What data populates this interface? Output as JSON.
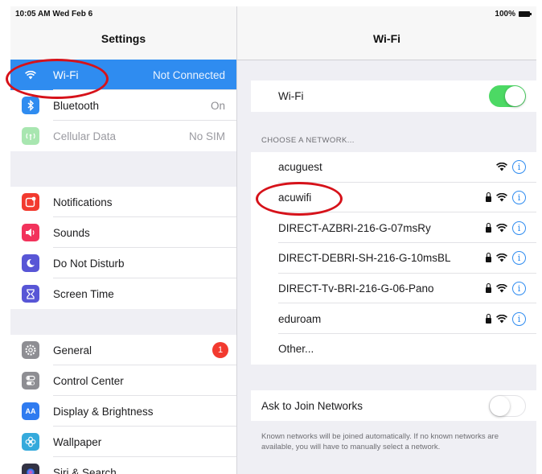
{
  "status_bar": {
    "time": "10:05 AM  Wed Feb 6",
    "battery": "100%"
  },
  "settings": {
    "title": "Settings",
    "groups": [
      [
        {
          "label": "Wi-Fi",
          "value": "Not Connected",
          "icon": "wifi-icon",
          "color": "#2f8cf0",
          "selected": true
        },
        {
          "label": "Bluetooth",
          "value": "On",
          "icon": "bluetooth-icon",
          "color": "#2f8cf0"
        },
        {
          "label": "Cellular Data",
          "value": "No SIM",
          "icon": "cellular-icon",
          "color": "#a8e6b0",
          "dim": true
        }
      ],
      [
        {
          "label": "Notifications",
          "icon": "notifications-icon",
          "color": "#f23a2f"
        },
        {
          "label": "Sounds",
          "icon": "sounds-icon",
          "color": "#f2335c"
        },
        {
          "label": "Do Not Disturb",
          "icon": "moon-icon",
          "color": "#5856d6"
        },
        {
          "label": "Screen Time",
          "icon": "hourglass-icon",
          "color": "#5856d6"
        }
      ],
      [
        {
          "label": "General",
          "icon": "gear-icon",
          "color": "#8e8e93",
          "badge": "1"
        },
        {
          "label": "Control Center",
          "icon": "toggles-icon",
          "color": "#8e8e93"
        },
        {
          "label": "Display & Brightness",
          "icon": "display-icon",
          "color": "#2f7bf0",
          "glyph": "AA"
        },
        {
          "label": "Wallpaper",
          "icon": "flower-icon",
          "color": "#35aadc"
        },
        {
          "label": "Siri & Search",
          "icon": "siri-icon",
          "color": "#333344"
        }
      ]
    ]
  },
  "wifi": {
    "title": "Wi-Fi",
    "toggle_label": "Wi-Fi",
    "toggle_on": true,
    "section_header": "CHOOSE A NETWORK...",
    "networks": [
      {
        "name": "acuguest",
        "secured": false
      },
      {
        "name": "acuwifi",
        "secured": true
      },
      {
        "name": "DIRECT-AZBRI-216-G-07msRy",
        "secured": true
      },
      {
        "name": "DIRECT-DEBRI-SH-216-G-10msBL",
        "secured": true
      },
      {
        "name": "DIRECT-Tv-BRI-216-G-06-Pano",
        "secured": true
      },
      {
        "name": "eduroam",
        "secured": true
      }
    ],
    "other_label": "Other...",
    "ask_label": "Ask to Join Networks",
    "ask_on": false,
    "footnote": "Known networks will be joined automatically. If no known networks are available, you will have to manually select a network."
  },
  "colors": {
    "accent": "#2f8cf0",
    "toggle_on": "#4cd964",
    "annotation": "#d6121a",
    "badge": "#f23a2f"
  }
}
